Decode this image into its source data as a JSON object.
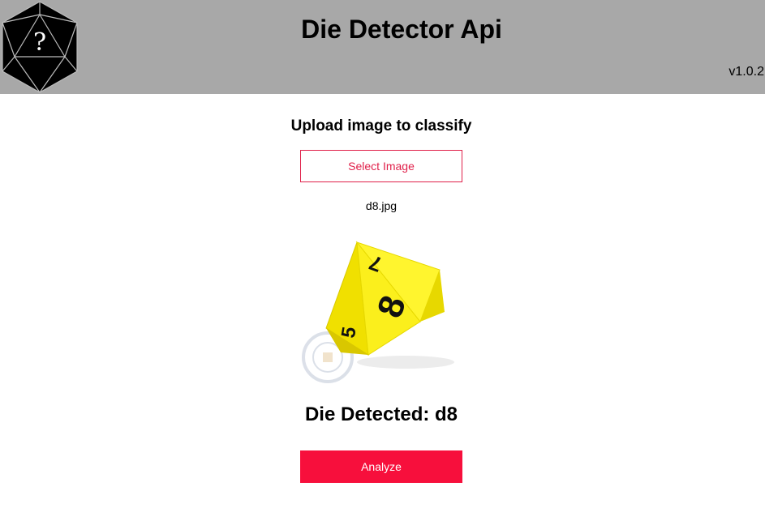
{
  "header": {
    "title": "Die Detector Api",
    "version": "v1.0.2",
    "logo_icon": "d20-question-icon",
    "logo_glyph": "?",
    "background_color": "#a8a8a8"
  },
  "upload": {
    "heading": "Upload image to classify",
    "select_button_label": "Select Image",
    "file_name": "d8.jpg",
    "accent_color": "#e0204a"
  },
  "preview": {
    "die_numbers": [
      "7",
      "8",
      "5"
    ]
  },
  "result": {
    "text": "Die Detected: d8"
  },
  "actions": {
    "analyze_button_label": "Analyze",
    "analyze_color": "#f70f3c"
  }
}
